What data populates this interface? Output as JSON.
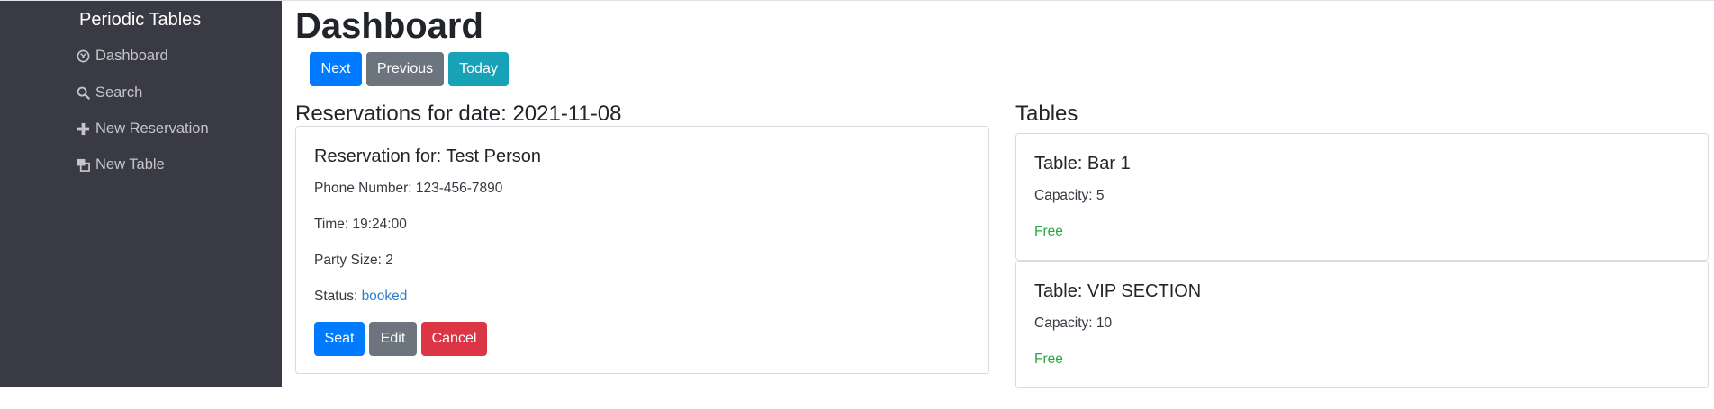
{
  "sidebar": {
    "brand": "Periodic Tables",
    "items": [
      {
        "label": "Dashboard",
        "icon": "dashboard-icon"
      },
      {
        "label": "Search",
        "icon": "search-icon"
      },
      {
        "label": "New Reservation",
        "icon": "plus-icon"
      },
      {
        "label": "New Table",
        "icon": "duplicate-icon"
      }
    ]
  },
  "page": {
    "title": "Dashboard",
    "buttons": {
      "next": "Next",
      "previous": "Previous",
      "today": "Today"
    }
  },
  "reservations": {
    "heading": "Reservations for date: 2021-11-08",
    "items": [
      {
        "title": "Reservation for: Test Person",
        "phone": "Phone Number: 123-456-7890",
        "time": "Time: 19:24:00",
        "party": "Party Size: 2",
        "status_label": "Status: ",
        "status_value": "booked",
        "actions": {
          "seat": "Seat",
          "edit": "Edit",
          "cancel": "Cancel"
        }
      }
    ]
  },
  "tables": {
    "heading": "Tables",
    "items": [
      {
        "title": "Table: Bar 1",
        "capacity": "Capacity: 5",
        "status": "Free"
      },
      {
        "title": "Table: VIP SECTION",
        "capacity": "Capacity: 10",
        "status": "Free"
      }
    ]
  },
  "colors": {
    "sidebar_bg": "#3a3a45",
    "primary": "#007bff",
    "secondary": "#6c757d",
    "info": "#17a2b8",
    "danger": "#dc3545",
    "success": "#28a745",
    "link": "#2b7fd1"
  }
}
